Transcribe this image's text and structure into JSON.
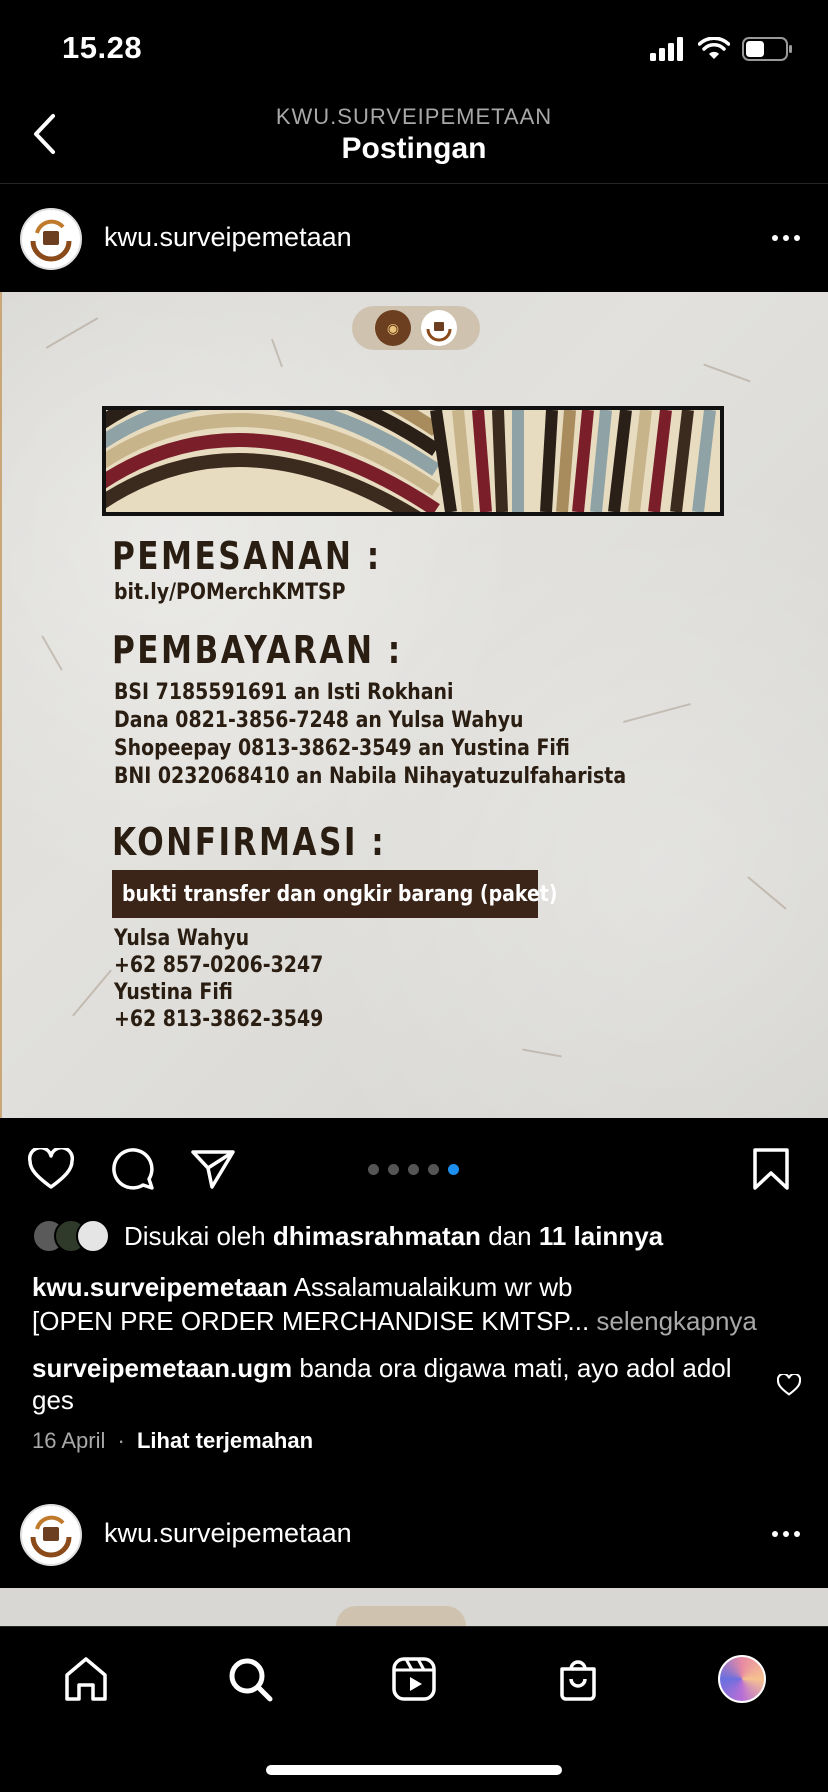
{
  "status": {
    "time": "15.28"
  },
  "header": {
    "subtitle": "KWU.SURVEIPEMETAAN",
    "title": "Postingan"
  },
  "post": {
    "username": "kwu.surveipemetaan",
    "image": {
      "heading_order": "PEMESANAN   :",
      "order_link": "bit.ly/POMerchKMTSP",
      "heading_payment": "PEMBAYARAN :",
      "payments": [
        " BSI 7185591691 an Isti Rokhani",
        "Dana 0821-3856-7248 an Yulsa Wahyu",
        "Shopeepay 0813-3862-3549 an Yustina Fifi",
        "BNI 0232068410 an Nabila Nihayatuzulfaharista"
      ],
      "heading_confirm": "KONFIRMASI :",
      "confirm_badge": "bukti transfer dan ongkir barang (paket)",
      "contacts": [
        "Yulsa Wahyu",
        "+62 857-0206-3247",
        "Yustina Fifi",
        "+62 813-3862-3549"
      ]
    },
    "carousel": {
      "total": 5,
      "active_index": 5
    },
    "likes": {
      "prefix": "Disukai oleh",
      "user": "dhimasrahmatan",
      "middle": "dan",
      "others": "11 lainnya"
    },
    "caption": {
      "user": "kwu.surveipemetaan",
      "line1": "Assalamualaikum wr wb",
      "line2": "[OPEN PRE ORDER MERCHANDISE KMTSP...",
      "more": "selengkapnya"
    },
    "comment": {
      "user": "surveipemetaan.ugm",
      "text": "banda ora digawa mati, ayo adol adol ges"
    },
    "meta": {
      "date": "16 April",
      "separator": "·",
      "translate": "Lihat terjemahan"
    }
  },
  "next_post": {
    "username": "kwu.surveipemetaan"
  },
  "icons": {
    "back": "chevron-left-icon",
    "more": "more-horizontal-icon",
    "like": "heart-icon",
    "comment": "comment-icon",
    "share": "send-icon",
    "save": "bookmark-icon",
    "tabs": [
      "home-icon",
      "search-icon",
      "reels-icon",
      "shop-icon",
      "profile-avatar"
    ]
  },
  "colors": {
    "accent": "#1c8ff0",
    "background": "#000000",
    "muted": "#a8a8a8"
  }
}
